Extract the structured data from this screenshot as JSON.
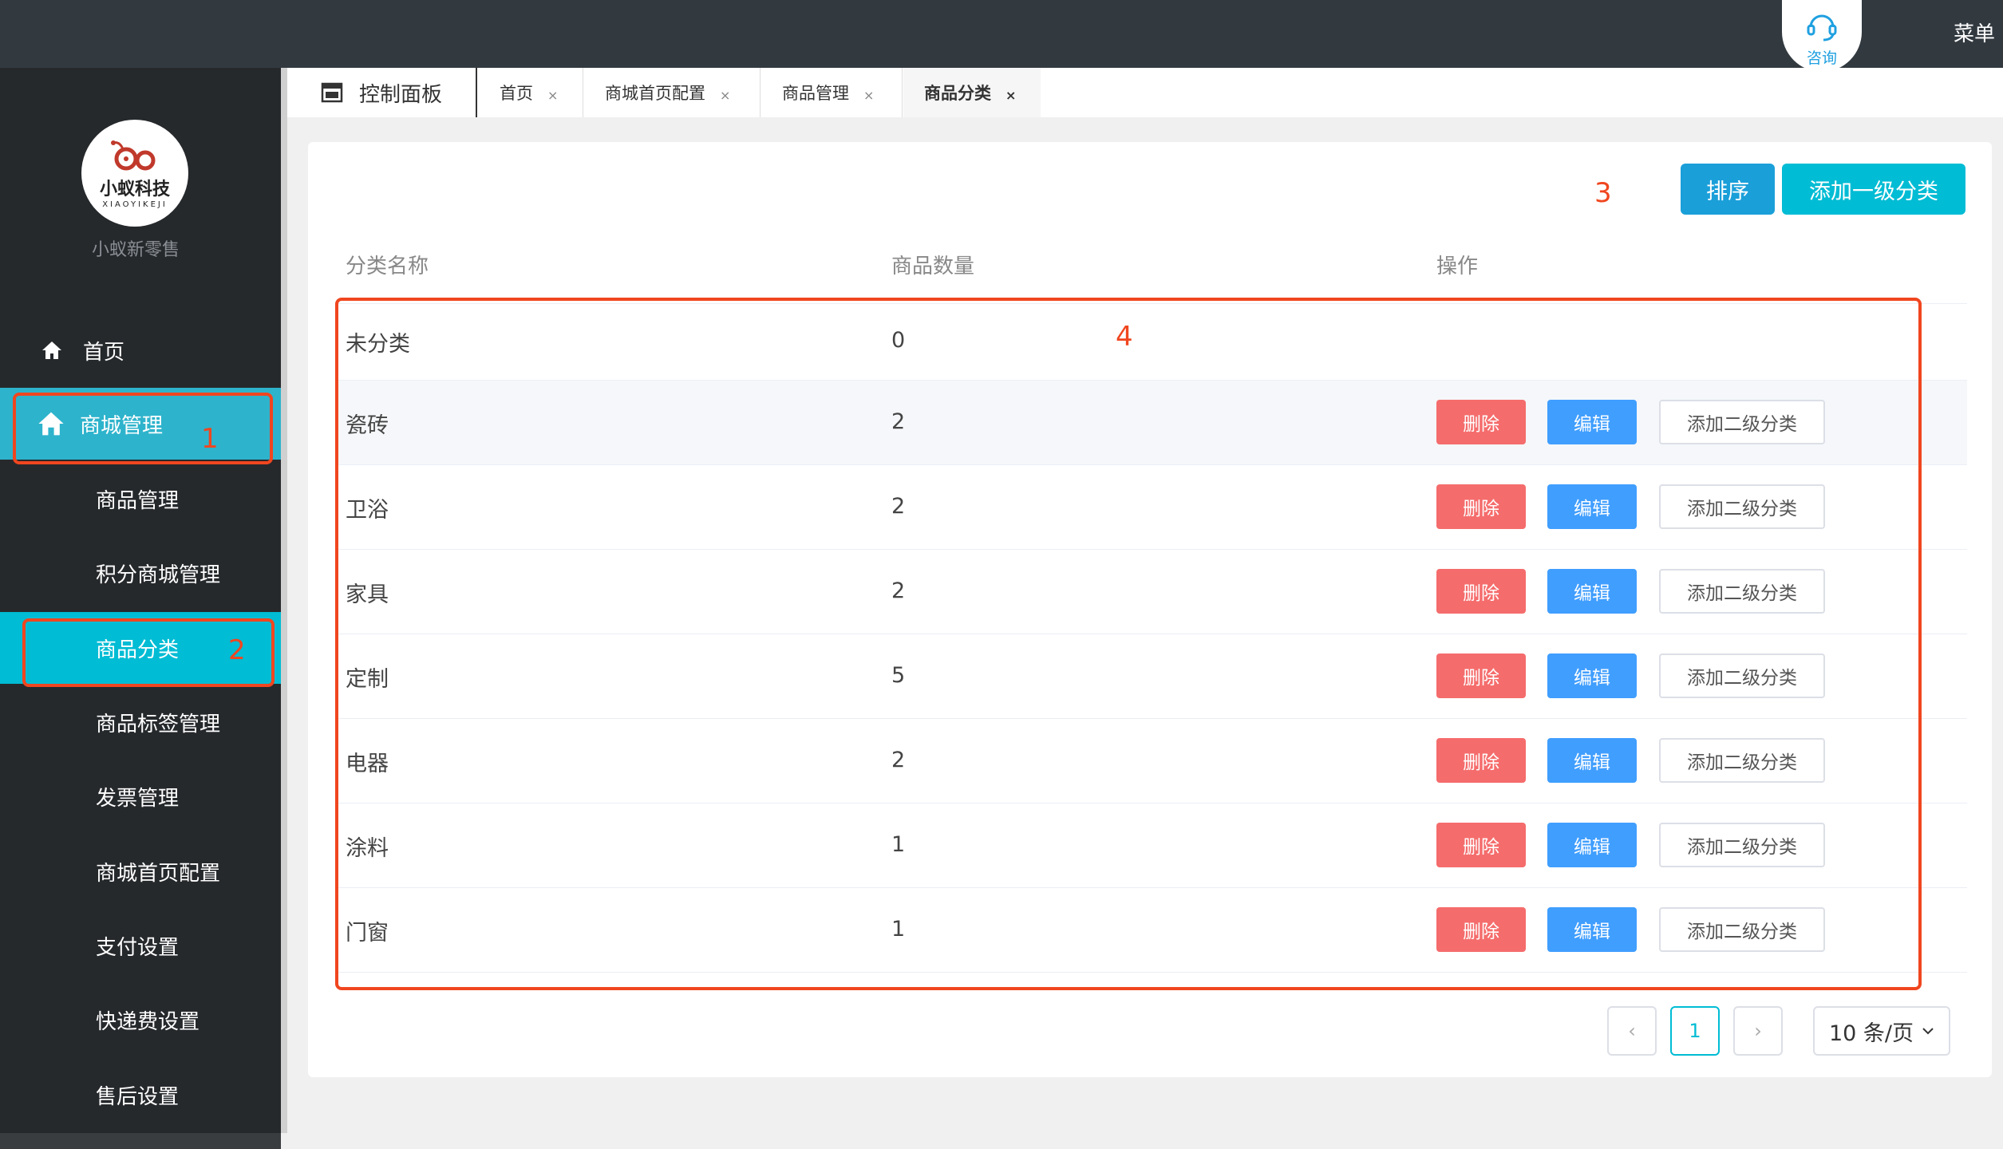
{
  "header": {
    "consult_label": "咨询",
    "menu_label": "菜单"
  },
  "sidebar": {
    "logo_text": "小蚁科技",
    "logo_sub": "XIAOYIKEJI",
    "brand": "小蚁新零售",
    "items": [
      {
        "label": "首页",
        "icon": "home-icon"
      },
      {
        "label": "商城管理",
        "icon": "home-icon"
      },
      {
        "label": "商品管理"
      },
      {
        "label": "积分商城管理"
      },
      {
        "label": "商品分类"
      },
      {
        "label": "商品标签管理"
      },
      {
        "label": "发票管理"
      },
      {
        "label": "商城首页配置"
      },
      {
        "label": "支付设置"
      },
      {
        "label": "快递费设置"
      },
      {
        "label": "售后设置"
      }
    ]
  },
  "annotations": {
    "a1": "1",
    "a2": "2",
    "a3": "3",
    "a4": "4"
  },
  "tabs": {
    "home": "控制面板",
    "items": [
      {
        "label": "首页",
        "close": "×"
      },
      {
        "label": "商城首页配置",
        "close": "×"
      },
      {
        "label": "商品管理",
        "close": "×"
      },
      {
        "label": "商品分类",
        "close": "×"
      }
    ]
  },
  "toolbar": {
    "sort_label": "排序",
    "add_label": "添加一级分类"
  },
  "table": {
    "headers": [
      "分类名称",
      "商品数量",
      "操作"
    ],
    "rows": [
      {
        "name": "未分类",
        "count": "0"
      },
      {
        "name": "瓷砖",
        "count": "2"
      },
      {
        "name": "卫浴",
        "count": "2"
      },
      {
        "name": "家具",
        "count": "2"
      },
      {
        "name": "定制",
        "count": "5"
      },
      {
        "name": "电器",
        "count": "2"
      },
      {
        "name": "涂料",
        "count": "1"
      },
      {
        "name": "门窗",
        "count": "1"
      }
    ],
    "actions": {
      "delete": "删除",
      "edit": "编辑",
      "add_sub": "添加二级分类"
    }
  },
  "pagination": {
    "prev": "‹",
    "current": "1",
    "next": "›",
    "page_size": "10 条/页"
  },
  "colors": {
    "accent": "#00bcd4",
    "danger": "#f56c6c",
    "primary": "#409eff",
    "annotation": "#f0461f"
  }
}
